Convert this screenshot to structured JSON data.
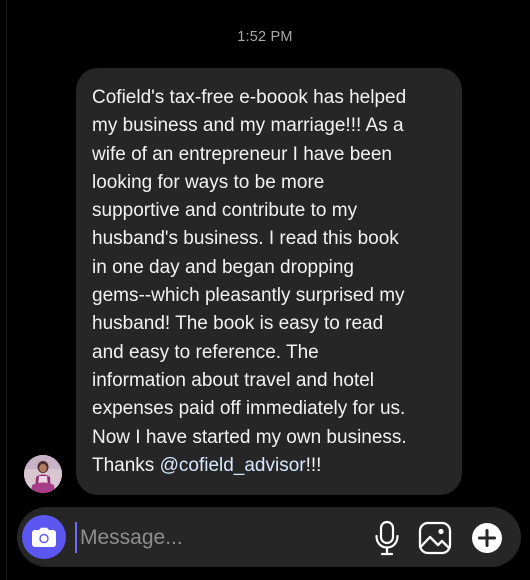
{
  "thread": {
    "timestamp": "1:52 PM"
  },
  "message": {
    "text_before_mention": "Cofield's tax-free e-boook has helped\nmy business and my marriage!!! As a\nwife of an entrepreneur I have been\nlooking for ways to be more\nsupportive and contribute to my\nhusband's business.  I read this book\nin one day and began dropping\ngems--which pleasantly surprised my\nhusband! The book is easy to read\nand easy to reference. The\ninformation about travel and hotel\nexpenses paid off immediately for us.\nNow I have started my own business.\nThanks ",
    "mention": "@cofield_advisor",
    "text_after_mention": "!!!"
  },
  "sender": {
    "avatar_icon": "user-avatar"
  },
  "composer": {
    "placeholder": "Message...",
    "camera_icon": "camera-icon",
    "mic_icon": "microphone-icon",
    "gallery_icon": "image-gallery-icon",
    "add_icon": "plus-icon"
  },
  "colors": {
    "background": "#000000",
    "bubble": "#262626",
    "accent": "#5b57f0",
    "text": "#f2f2f2",
    "muted": "#a9a9a9"
  }
}
